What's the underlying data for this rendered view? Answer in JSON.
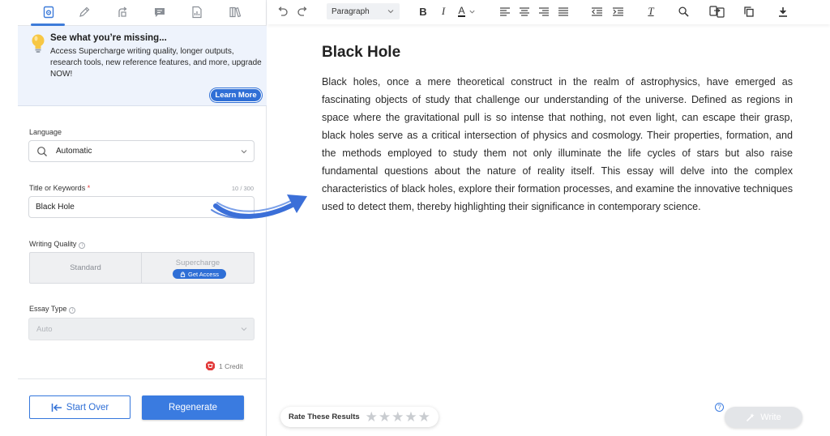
{
  "sidebar": {
    "tabs": [
      {
        "icon": "gear-doc-icon"
      },
      {
        "icon": "pencil-icon"
      },
      {
        "icon": "rewrite-icon"
      },
      {
        "icon": "chat-icon"
      },
      {
        "icon": "document-chart-icon"
      },
      {
        "icon": "books-icon"
      }
    ],
    "upgrade": {
      "title": "See what you’re missing...",
      "body": "Access Supercharge writing quality, longer outputs, research tools, new reference features, and more, upgrade NOW!",
      "button": "Learn More"
    },
    "language": {
      "label": "Language",
      "value": "Automatic"
    },
    "title_keywords": {
      "label": "Title or Keywords",
      "required_mark": "*",
      "count": "10 / 300",
      "value": "Black Hole"
    },
    "writing_quality": {
      "label": "Writing Quality",
      "info": "i",
      "standard": "Standard",
      "supercharge": "Supercharge",
      "get_access": "Get Access"
    },
    "essay_type": {
      "label": "Essay Type",
      "info": "i",
      "value": "Auto"
    },
    "credit": "1 Credit",
    "start_over": "Start Over",
    "regenerate": "Regenerate"
  },
  "toolbar": {
    "paragraph": "Paragraph",
    "bold": "B",
    "italic": "I",
    "font_color": "A",
    "clear_format": "T"
  },
  "document": {
    "title": "Black Hole",
    "body": "Black holes, once a mere theoretical construct in the realm of astrophysics, have emerged as fascinating objects of study that challenge our understanding of the universe. Defined as regions in space where the gravitational pull is so intense that nothing, not even light, can escape their grasp, black holes serve as a critical intersection of physics and cosmology. Their properties, formation, and the methods employed to study them not only illuminate the life cycles of stars but also raise fundamental questions about the nature of reality itself. This essay will delve into the complex characteristics of black holes, explore their formation processes, and examine the innovative techniques used to detect them, thereby highlighting their significance in contemporary science."
  },
  "footer": {
    "rate_label": "Rate These Results",
    "stars": [
      "★",
      "★",
      "★",
      "★",
      "★"
    ],
    "help": "?",
    "write": "Write"
  },
  "colors": {
    "accent": "#2f6fd6",
    "arrow": "#3b6fd8"
  }
}
